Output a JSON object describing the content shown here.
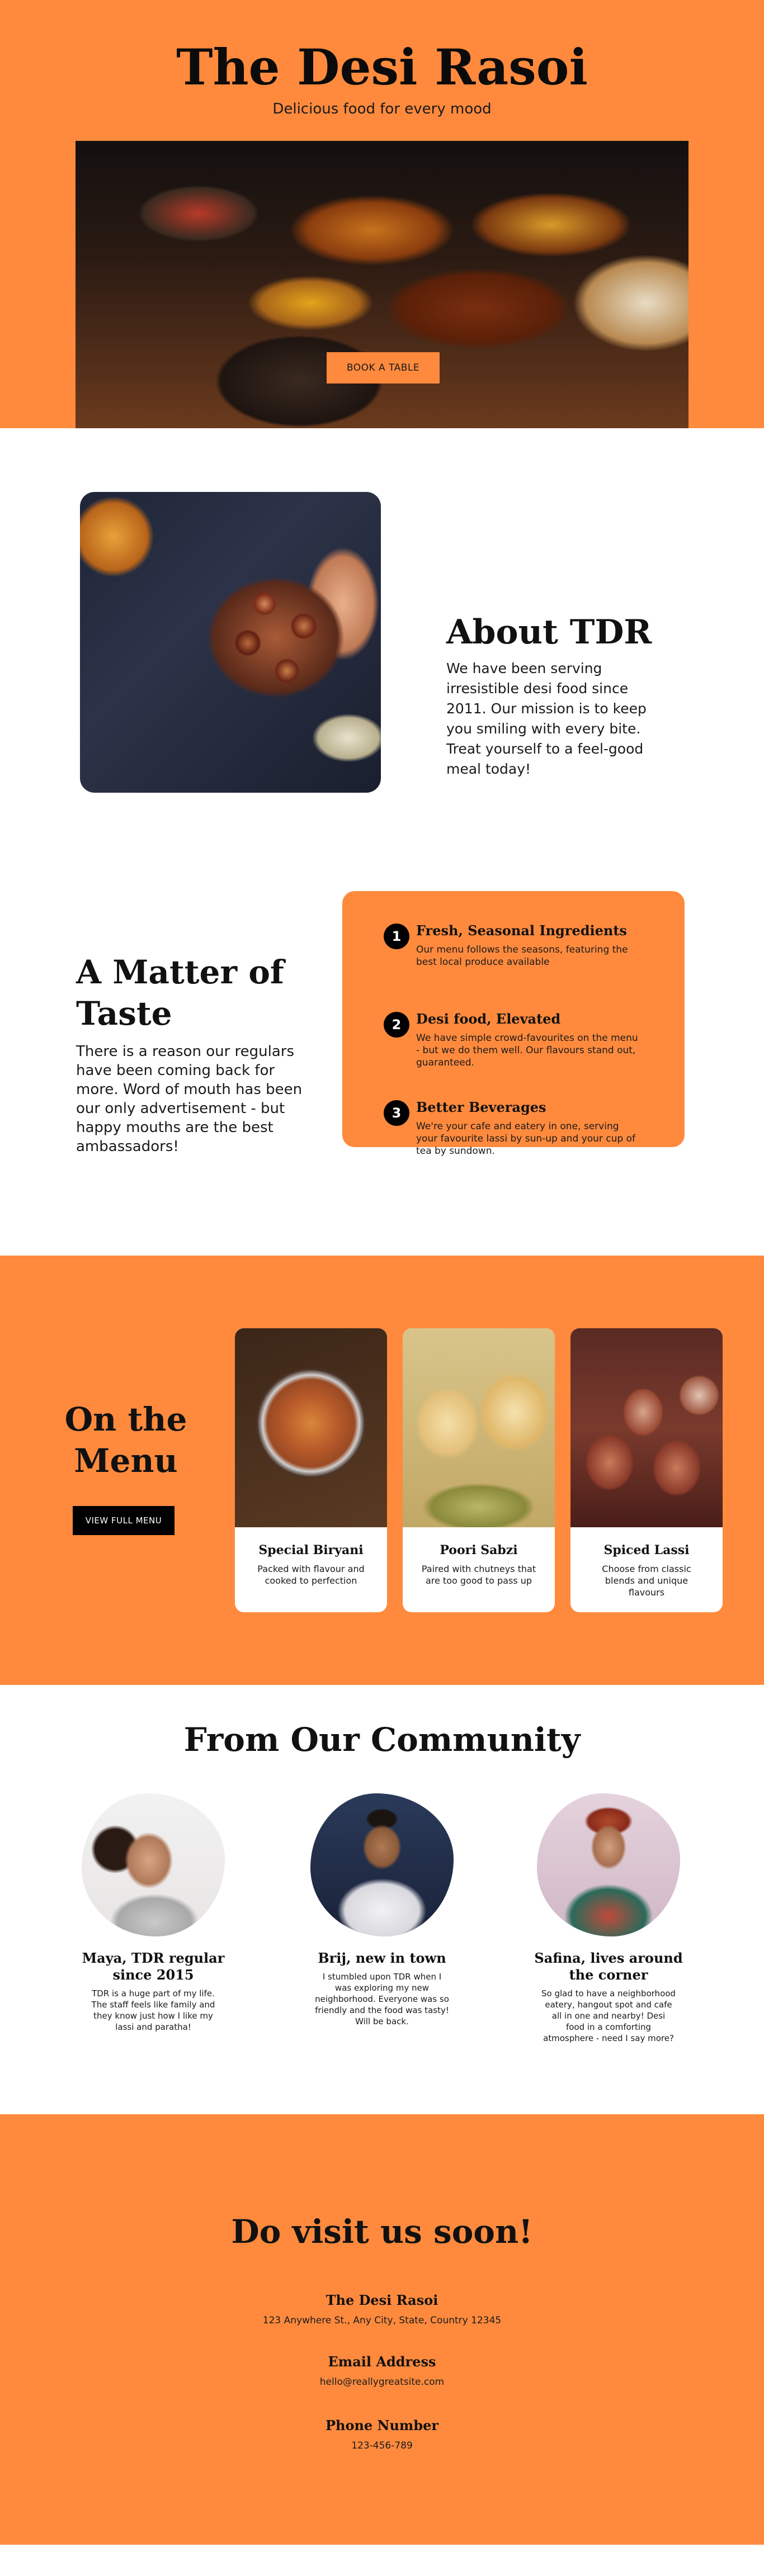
{
  "hero": {
    "title": "The Desi Rasoi",
    "tagline": "Delicious food for every mood",
    "book_label": "BOOK A TABLE"
  },
  "about": {
    "heading": "About TDR",
    "text": "We have been serving irresistible desi food since 2011. Our mission is to keep you smiling with every bite. Treat yourself to a feel-good meal today!"
  },
  "taste": {
    "heading": "A Matter of Taste",
    "text": "There is a reason our regulars have been coming back for more. Word of mouth has been our only advertisement - but happy mouths are the best ambassadors!",
    "steps": [
      {
        "num": "1",
        "title": "Fresh, Seasonal Ingredients",
        "text": "Our menu follows the seasons, featuring the best local produce available"
      },
      {
        "num": "2",
        "title": "Desi food, Elevated",
        "text": "We have simple crowd-favourites on the menu - but we do them well. Our flavours stand out, guaranteed."
      },
      {
        "num": "3",
        "title": "Better Beverages",
        "text": "We're your cafe and eatery in one, serving your favourite lassi by sun-up and your cup of tea by sundown."
      }
    ]
  },
  "menu": {
    "heading": "On the Menu",
    "button_label": "VIEW FULL MENU",
    "dishes": [
      {
        "name": "Special Biryani",
        "desc": "Packed with flavour and cooked to perfection"
      },
      {
        "name": "Poori Sabzi",
        "desc": "Paired with chutneys that are too good to pass up"
      },
      {
        "name": "Spiced Lassi",
        "desc": "Choose from classic blends and unique flavours"
      }
    ]
  },
  "community": {
    "heading": "From Our Community",
    "people": [
      {
        "name": "Maya, TDR regular since 2015",
        "quote": "TDR is a huge part of my life. The staff feels like family and they know just how I like my lassi and paratha!"
      },
      {
        "name": "Brij, new in town",
        "quote": "I stumbled upon TDR when I was exploring my new neighborhood. Everyone was so friendly and the food was tasty! Will be back."
      },
      {
        "name": "Safina, lives around the corner",
        "quote": "So glad to have a neighborhood eatery, hangout spot and cafe all in one and nearby! Desi food in a comforting atmosphere - need I say more?"
      }
    ]
  },
  "visit": {
    "heading": "Do visit us soon!",
    "name_label": "The Desi Rasoi",
    "address": "123 Anywhere St., Any City, State, Country 12345",
    "email_label": "Email Address",
    "email": "hello@reallygreatsite.com",
    "phone_label": "Phone Number",
    "phone": "123-456-789"
  },
  "colors": {
    "accent": "#FF8A3D",
    "ink": "#0B0B0B",
    "button_dark": "#000000"
  }
}
